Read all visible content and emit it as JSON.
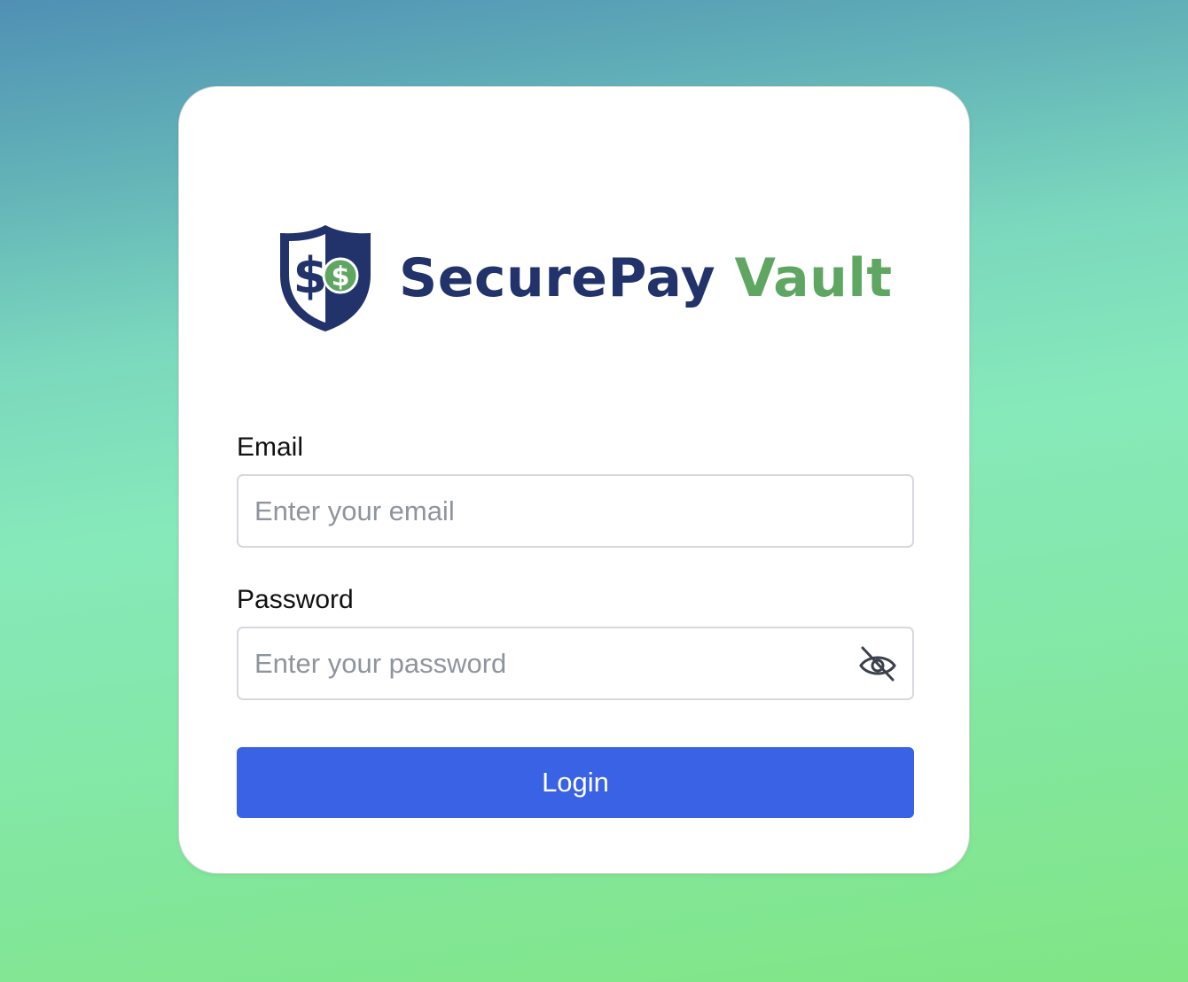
{
  "brand": {
    "name": "SecurePay",
    "accent_word": "Vault",
    "name_color": "#22336b",
    "accent_color": "#5fa662",
    "logo_icon": "shield-dollar-icon"
  },
  "form": {
    "email": {
      "label": "Email",
      "placeholder": "Enter your email",
      "value": ""
    },
    "password": {
      "label": "Password",
      "placeholder": "Enter your password",
      "value": "",
      "toggle_icon": "eye-off-icon"
    },
    "login_label": "Login",
    "button_color": "#3963e4"
  }
}
